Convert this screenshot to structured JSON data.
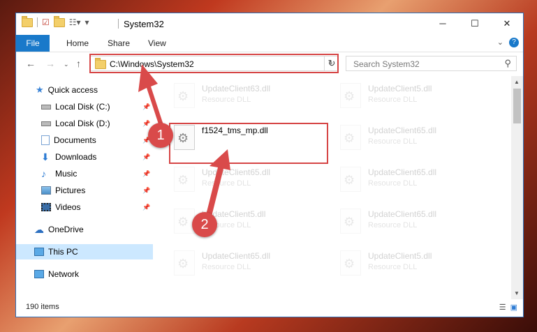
{
  "window": {
    "title": "System32",
    "controls": {
      "minimize": "─",
      "maximize": "☐",
      "close": "✕"
    }
  },
  "ribbon": {
    "tabs": [
      "File",
      "Home",
      "Share",
      "View"
    ],
    "help": "?"
  },
  "nav": {
    "address": "C:\\Windows\\System32",
    "search_placeholder": "Search System32"
  },
  "sidebar": {
    "items": [
      {
        "label": "Quick access",
        "icon": "star-icon",
        "pinned": false
      },
      {
        "label": "Local Disk (C:)",
        "icon": "drive-icon",
        "pinned": true
      },
      {
        "label": "Local Disk (D:)",
        "icon": "drive-icon",
        "pinned": true
      },
      {
        "label": "Documents",
        "icon": "documents-icon",
        "pinned": true
      },
      {
        "label": "Downloads",
        "icon": "download-icon",
        "pinned": true
      },
      {
        "label": "Music",
        "icon": "music-icon",
        "pinned": true
      },
      {
        "label": "Pictures",
        "icon": "pictures-icon",
        "pinned": true
      },
      {
        "label": "Videos",
        "icon": "videos-icon",
        "pinned": true
      },
      {
        "label": "OneDrive",
        "icon": "cloud-icon",
        "pinned": false
      },
      {
        "label": "This PC",
        "icon": "monitor-icon",
        "pinned": false,
        "selected": true
      },
      {
        "label": "Network",
        "icon": "network-icon",
        "pinned": false
      }
    ]
  },
  "files": {
    "highlighted": {
      "name": "f1524_tms_mp.dll"
    },
    "faded": [
      {
        "name": "UpdateClient63.dll",
        "type": "Resource DLL"
      },
      {
        "name": "UpdateClient5.dll",
        "type": "Resource DLL"
      },
      {
        "name": "UpdateClient65.dll",
        "type": "Resource DLL"
      },
      {
        "name": "UpdateClient65.dll",
        "type": "Resource DLL"
      },
      {
        "name": "UpdateClient65.dll",
        "type": "Resource DLL"
      },
      {
        "name": "UpdateClient5.dll",
        "type": "Resource DLL"
      },
      {
        "name": "UpdateClient65.dll",
        "type": "Resource DLL"
      },
      {
        "name": "UpdateClient65.dll",
        "type": "Resource DLL"
      },
      {
        "name": "UpdateClient5.dll",
        "type": "Resource DLL"
      }
    ]
  },
  "status": {
    "item_count": "190 items"
  },
  "annotations": {
    "step1": "1",
    "step2": "2",
    "color": "#d94a4a"
  }
}
